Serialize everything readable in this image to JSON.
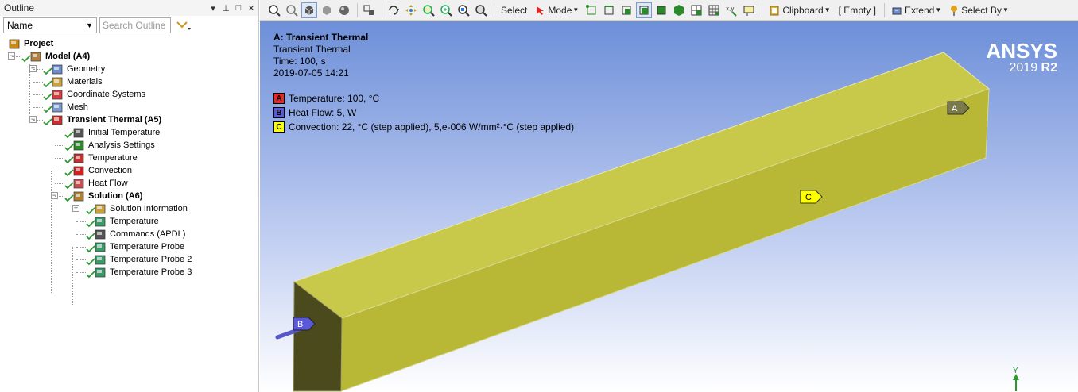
{
  "outline": {
    "title": "Outline",
    "filter_name": "Name",
    "search_placeholder": "Search Outline",
    "tree": [
      {
        "label": "Project",
        "bold": true,
        "level": 0,
        "icon": "project-icon"
      },
      {
        "label": "Model (A4)",
        "bold": true,
        "level": 1,
        "icon": "model-icon"
      },
      {
        "label": "Geometry",
        "level": 2,
        "icon": "geometry-icon"
      },
      {
        "label": "Materials",
        "level": 2,
        "icon": "materials-icon"
      },
      {
        "label": "Coordinate Systems",
        "level": 2,
        "icon": "coordinate-systems-icon"
      },
      {
        "label": "Mesh",
        "level": 2,
        "icon": "mesh-icon"
      },
      {
        "label": "Transient Thermal (A5)",
        "bold": true,
        "level": 2,
        "icon": "transient-thermal-icon"
      },
      {
        "label": "Initial Temperature",
        "level": 3,
        "icon": "initial-temperature-icon"
      },
      {
        "label": "Analysis Settings",
        "level": 3,
        "icon": "analysis-settings-icon"
      },
      {
        "label": "Temperature",
        "level": 3,
        "icon": "temperature-icon"
      },
      {
        "label": "Convection",
        "level": 3,
        "icon": "convection-icon"
      },
      {
        "label": "Heat Flow",
        "level": 3,
        "icon": "heat-flow-icon"
      },
      {
        "label": "Solution (A6)",
        "bold": true,
        "level": 3,
        "icon": "solution-icon"
      },
      {
        "label": "Solution Information",
        "level": 4,
        "icon": "solution-information-icon"
      },
      {
        "label": "Temperature",
        "level": 4,
        "icon": "temperature-result-icon"
      },
      {
        "label": "Commands (APDL)",
        "level": 4,
        "icon": "commands-icon"
      },
      {
        "label": "Temperature Probe",
        "level": 4,
        "icon": "probe-icon"
      },
      {
        "label": "Temperature Probe 2",
        "level": 4,
        "icon": "probe-icon"
      },
      {
        "label": "Temperature Probe 3",
        "level": 4,
        "icon": "probe-icon"
      }
    ]
  },
  "toolbar": {
    "select": "Select",
    "mode": "Mode",
    "clipboard": "Clipboard",
    "empty": "[ Empty ]",
    "extend": "Extend",
    "select_by": "Select By"
  },
  "viewport": {
    "title": "A: Transient Thermal",
    "subtitle": "Transient Thermal",
    "time": "Time: 100, s",
    "date": "2019-07-05 14:21",
    "legend": [
      {
        "letter": "A",
        "text": "Temperature: 100, °C",
        "color": "#e8262b"
      },
      {
        "letter": "B",
        "text": "Heat Flow: 5, W",
        "color": "#5a5ad8"
      },
      {
        "letter": "C",
        "text": "Convection: 22, °C  (step applied), 5,e-006 W/mm²·°C  (step applied)",
        "color": "#ffff00"
      }
    ],
    "brand": "ANSYS",
    "version": "2019",
    "release": "R2",
    "axis_y": "Y",
    "marker_a": "A",
    "marker_b": "B",
    "marker_c": "C"
  },
  "colors": {
    "body_top": "#c8c84a",
    "body_front": "#b9b934",
    "body_end": "#4b4a1a",
    "check": "#2e9a2e"
  }
}
